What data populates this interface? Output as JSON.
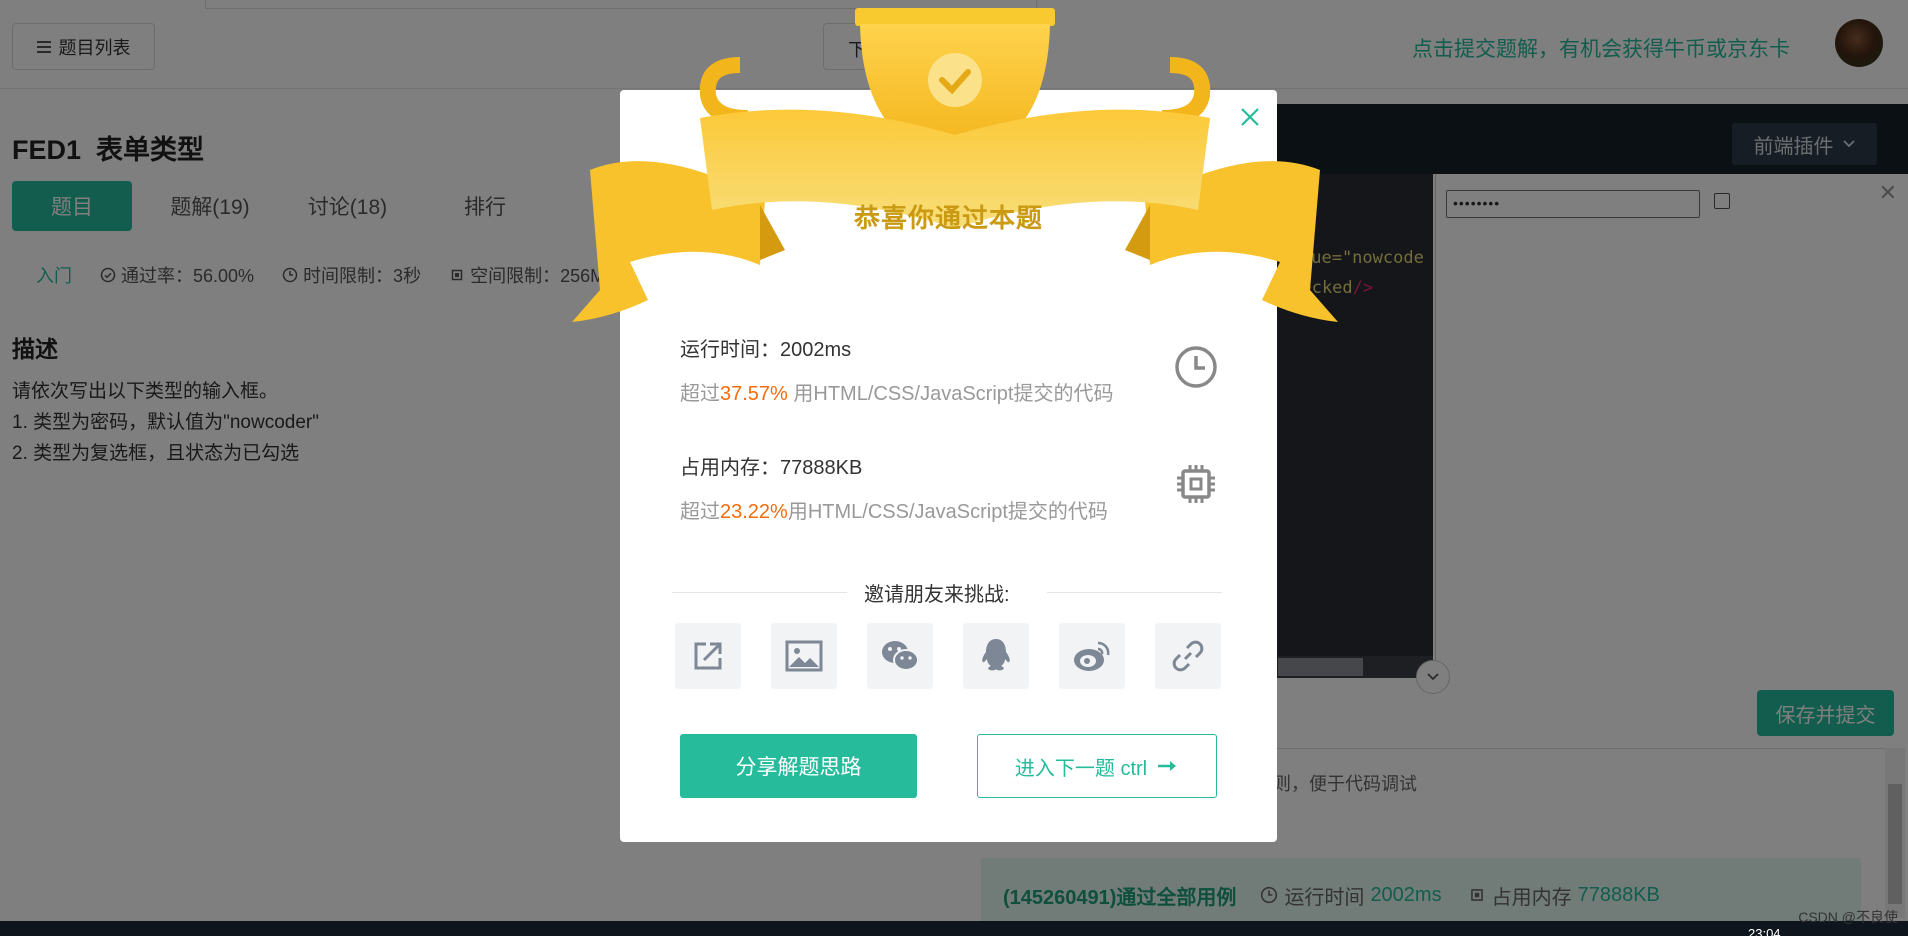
{
  "header": {
    "list_button": "题目列表",
    "mid_button": "下",
    "promo": "点击提交题解，有机会获得牛币或京东卡"
  },
  "problem": {
    "id": "FED1",
    "title": "表单类型",
    "tabs": [
      "题目",
      "题解(19)",
      "讨论(18)",
      "排行"
    ],
    "level": "入门",
    "pass_rate": "通过率：56.00%",
    "time_limit": "时间限制：3秒",
    "space_limit": "空间限制：256M",
    "desc_heading": "描述",
    "desc_lines": [
      "请依次写出以下类型的输入框。",
      "1. 类型为密码，默认值为\"nowcoder\"",
      "2. 类型为复选框，且状态为已勾选"
    ]
  },
  "editor": {
    "plugin_button": "前端插件",
    "code_line1": "lue=\"nowcode",
    "code_line2_a": "checked",
    "code_line2_b": "/>",
    "preview_password": "••••••••",
    "save_button": "保存并提交",
    "console_hint": "则，便于代码调试",
    "result_ok": "(145260491)通过全部用例",
    "result_time_label": "运行时间",
    "result_time_value": "2002ms",
    "result_mem_label": "占用内存",
    "result_mem_value": "77888KB"
  },
  "modal": {
    "title": "恭喜你通过本题",
    "runtime_label": "运行时间：2002ms",
    "runtime_prefix": "超过",
    "runtime_pct": "37.57%",
    "runtime_suffix": " 用HTML/CSS/JavaScript提交的代码",
    "memory_label": "占用内存：77888KB",
    "memory_prefix": "超过",
    "memory_pct": "23.22%",
    "memory_suffix": "用HTML/CSS/JavaScript提交的代码",
    "invite": "邀请朋友来挑战:",
    "share_icons": [
      "share-out-icon",
      "image-icon",
      "wechat-icon",
      "qq-icon",
      "weibo-icon",
      "link-icon"
    ],
    "share_button": "分享解题思路",
    "next_button": "进入下一题 ctrl"
  },
  "taskbar": {
    "watermark": "CSDN @不良使",
    "clock": "23:04"
  },
  "colors": {
    "accent": "#25bb9b",
    "highlight": "#f56c0a",
    "gold": "#f5c330"
  }
}
